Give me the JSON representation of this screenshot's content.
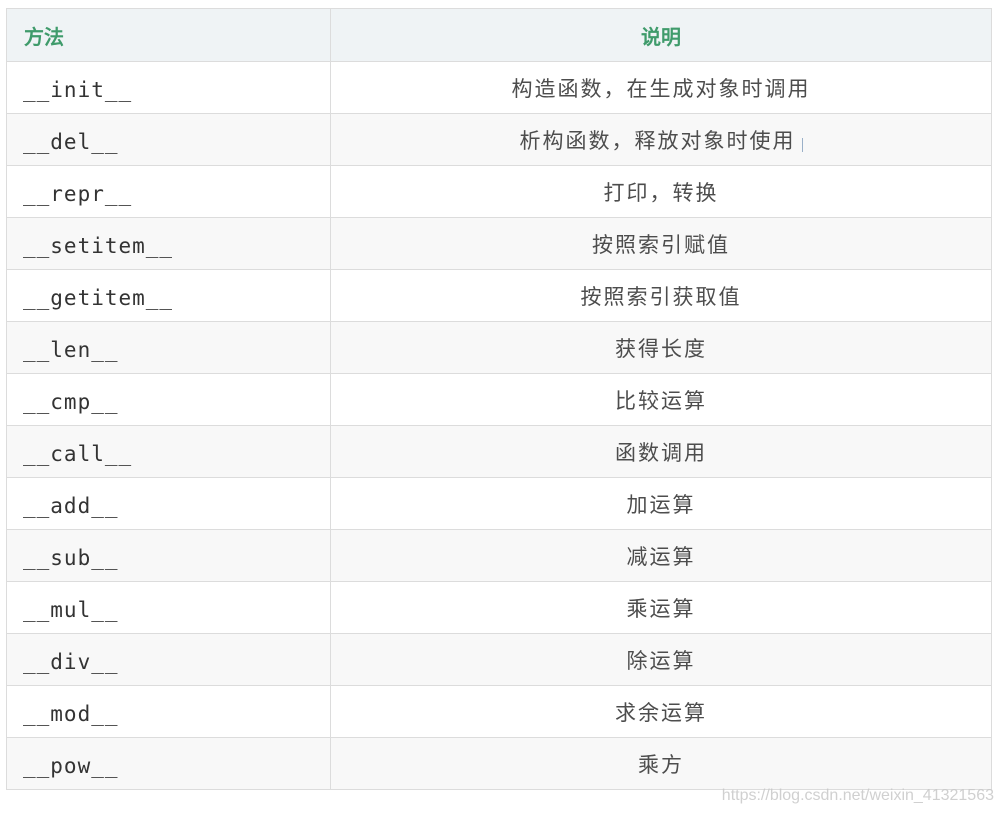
{
  "table": {
    "headers": {
      "method": "方法",
      "description": "说明"
    },
    "rows": [
      {
        "method": "__init__",
        "description": "构造函数，在生成对象时调用"
      },
      {
        "method": "__del__",
        "description": "析构函数，释放对象时使用"
      },
      {
        "method": "__repr__",
        "description": "打印，转换"
      },
      {
        "method": "__setitem__",
        "description": "按照索引赋值"
      },
      {
        "method": "__getitem__",
        "description": "按照索引获取值"
      },
      {
        "method": "__len__",
        "description": "获得长度"
      },
      {
        "method": "__cmp__",
        "description": "比较运算"
      },
      {
        "method": "__call__",
        "description": "函数调用"
      },
      {
        "method": "__add__",
        "description": "加运算"
      },
      {
        "method": "__sub__",
        "description": "减运算"
      },
      {
        "method": "__mul__",
        "description": "乘运算"
      },
      {
        "method": "__div__",
        "description": "除运算"
      },
      {
        "method": "__mod__",
        "description": "求余运算"
      },
      {
        "method": "__pow__",
        "description": "乘方"
      }
    ]
  },
  "watermark": "https://blog.csdn.net/weixin_41321563",
  "colors": {
    "header_text": "#3f9b6b",
    "header_bg": "#eff3f5",
    "border": "#dcdcdc",
    "stripe": "#f8f8f8"
  }
}
